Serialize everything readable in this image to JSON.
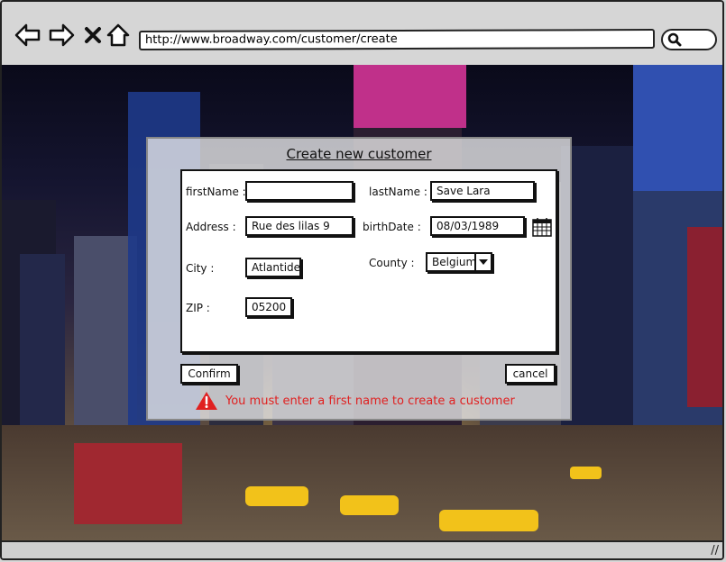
{
  "browser": {
    "url": "http://www.broadway.com/customer/create"
  },
  "dialog": {
    "title": "Create new customer",
    "fields": {
      "first_name": {
        "label": "firstName :",
        "value": ""
      },
      "last_name": {
        "label": "lastName :",
        "value": "Save Lara"
      },
      "address": {
        "label": "Address :",
        "value": "Rue des lilas 9"
      },
      "birth_date": {
        "label": "birthDate :",
        "value": "08/03/1989"
      },
      "city": {
        "label": "City :",
        "value": "Atlantide"
      },
      "county": {
        "label": "County :",
        "value": "Belgium"
      },
      "zip": {
        "label": "ZIP :",
        "value": "05200"
      }
    },
    "confirm_label": "Confirm",
    "cancel_label": "cancel",
    "error_message": "You must enter a first name to create a customer"
  },
  "colors": {
    "error": "#e02020",
    "chrome": "#d6d6d6"
  }
}
